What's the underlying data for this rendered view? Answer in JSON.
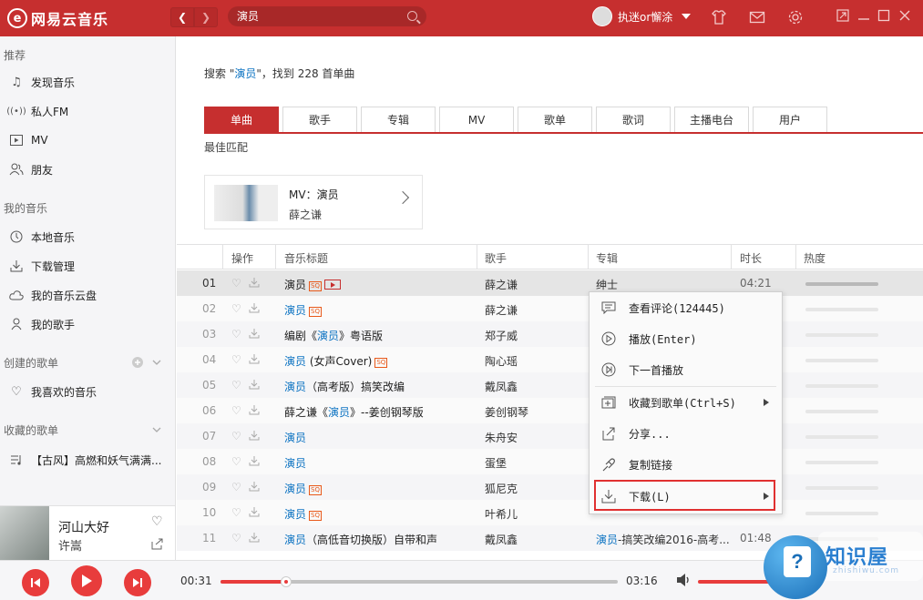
{
  "app": {
    "logo_text": "网易云音乐",
    "search_value": "演员",
    "username": "执迷or懈涂"
  },
  "sidebar": {
    "sections": [
      {
        "title": "推荐",
        "items": [
          "发现音乐",
          "私人FM",
          "MV",
          "朋友"
        ]
      },
      {
        "title": "我的音乐",
        "items": [
          "本地音乐",
          "下载管理",
          "我的音乐云盘",
          "我的歌手"
        ]
      },
      {
        "title": "创建的歌单",
        "items": [
          "我喜欢的音乐"
        ]
      },
      {
        "title": "收藏的歌单",
        "items": [
          "【古风】高燃和妖气满满..."
        ]
      }
    ]
  },
  "now_playing": {
    "title": "河山大好",
    "artist": "许嵩"
  },
  "search": {
    "summary_prefix": "搜索 \"",
    "summary_keyword": "演员",
    "summary_suffix": "\"，找到 228 首单曲",
    "tabs": [
      "单曲",
      "歌手",
      "专辑",
      "MV",
      "歌单",
      "歌词",
      "主播电台",
      "用户"
    ],
    "active_tab": "单曲",
    "best_match_label": "最佳匹配",
    "mv_card": {
      "title": "MV：演员",
      "artist": "薛之谦"
    }
  },
  "table": {
    "headers": [
      "操作",
      "音乐标题",
      "歌手",
      "专辑",
      "时长",
      "热度"
    ],
    "rows": [
      {
        "index": "01",
        "title_pre": "",
        "title_hl": "",
        "title_plain": "演员",
        "title_post": "",
        "badge_sq": true,
        "badge_mv": true,
        "artist": "薛之谦",
        "album": "绅士",
        "duration": "04:21"
      },
      {
        "index": "02",
        "title_pre": "",
        "title_hl": "演员",
        "title_plain": "",
        "title_post": "",
        "badge_sq": true,
        "badge_mv": false,
        "artist": "薛之谦",
        "album": "",
        "duration": ""
      },
      {
        "index": "03",
        "title_pre": "编剧《",
        "title_hl": "演员",
        "title_plain": "",
        "title_post": "》粤语版",
        "badge_sq": false,
        "badge_mv": false,
        "artist": "郑子威",
        "album": "",
        "duration": ""
      },
      {
        "index": "04",
        "title_pre": "",
        "title_hl": "演员",
        "title_plain": "",
        "title_post": " (女声Cover)",
        "badge_sq": true,
        "badge_mv": false,
        "artist": "陶心瑶",
        "album": "",
        "duration": ""
      },
      {
        "index": "05",
        "title_pre": "",
        "title_hl": "演员",
        "title_plain": "",
        "title_post": "（高考版）搞笑改编",
        "badge_sq": false,
        "badge_mv": false,
        "artist": "戴凤鑫",
        "album": "",
        "duration": ""
      },
      {
        "index": "06",
        "title_pre": "薛之谦《",
        "title_hl": "演员",
        "title_plain": "",
        "title_post": "》--姜创钢琴版",
        "badge_sq": false,
        "badge_mv": false,
        "artist": "姜创钢琴",
        "album": "",
        "duration": ""
      },
      {
        "index": "07",
        "title_pre": "",
        "title_hl": "演员",
        "title_plain": "",
        "title_post": "",
        "badge_sq": false,
        "badge_mv": false,
        "artist": "朱舟安",
        "album": "",
        "duration": ""
      },
      {
        "index": "08",
        "title_pre": "",
        "title_hl": "演员",
        "title_plain": "",
        "title_post": "",
        "badge_sq": false,
        "badge_mv": false,
        "artist": "蛋堡",
        "album": "",
        "duration": ""
      },
      {
        "index": "09",
        "title_pre": "",
        "title_hl": "演员",
        "title_plain": "",
        "title_post": "",
        "badge_sq": true,
        "badge_mv": false,
        "artist": "狐尼克",
        "album": "",
        "duration": ""
      },
      {
        "index": "10",
        "title_pre": "",
        "title_hl": "演员",
        "title_plain": "",
        "title_post": "",
        "badge_sq": true,
        "badge_mv": false,
        "artist": "叶希儿",
        "album": "",
        "duration": ""
      },
      {
        "index": "11",
        "title_pre": "",
        "title_hl": "演员",
        "title_plain": "",
        "title_post": "（高低音切换版）自带和声",
        "badge_sq": false,
        "badge_mv": false,
        "artist": "戴凤鑫",
        "album_hl": "演员",
        "album": "-搞笑改编2016-高考...",
        "duration": "01:48"
      }
    ]
  },
  "context_menu": {
    "items": [
      {
        "icon": "comment-icon",
        "label": "查看评论(124445)"
      },
      {
        "icon": "play-icon",
        "label": "播放(Enter)"
      },
      {
        "icon": "play-next-icon",
        "label": "下一首播放"
      },
      {
        "icon": "add-to-playlist-icon",
        "label": "收藏到歌单(Ctrl+S)"
      },
      {
        "icon": "share-icon",
        "label": "分享..."
      },
      {
        "icon": "link-icon",
        "label": "复制链接"
      },
      {
        "icon": "download-icon",
        "label": "下载(L)"
      }
    ],
    "highlighted_item": "下载(L)"
  },
  "player": {
    "current_time": "00:31",
    "total_time": "03:16",
    "progress": 0.165
  },
  "watermark": {
    "text": "知识屋",
    "sub": "zhishiwu.com"
  },
  "colors": {
    "brand": "#c62f2f",
    "link": "#0c73c2",
    "highlight_border": "#e03030"
  }
}
